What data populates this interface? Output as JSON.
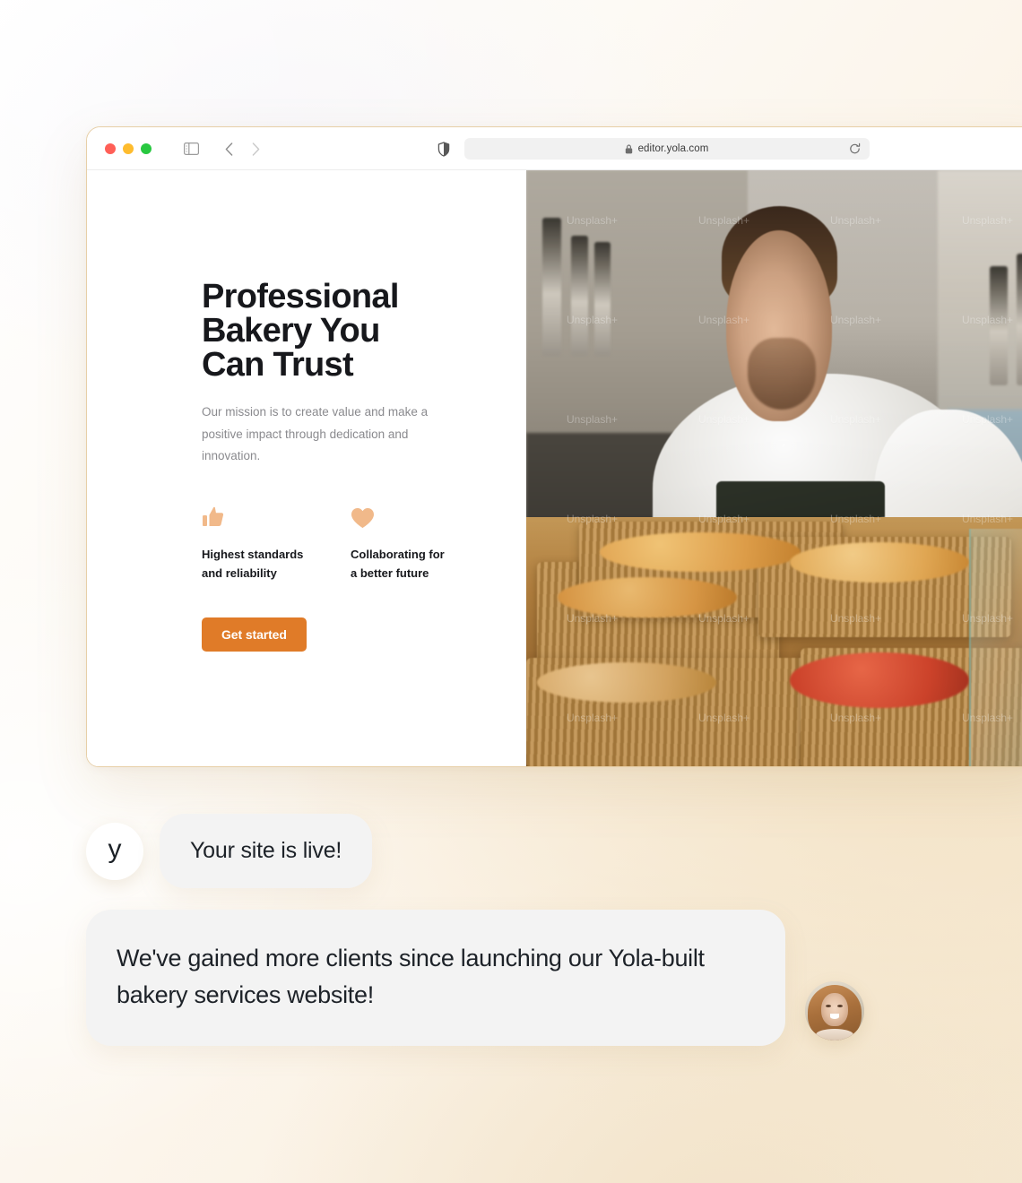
{
  "browser": {
    "traffic_lights": [
      "close",
      "minimize",
      "maximize"
    ],
    "url": "editor.yola.com",
    "lock_icon": "lock-icon",
    "reload_icon": "reload-icon",
    "sidebar_icon": "sidebar-toggle-icon",
    "back_icon": "chevron-left-icon",
    "forward_icon": "chevron-right-icon",
    "shield_icon": "privacy-shield-icon"
  },
  "site": {
    "hero": {
      "title": "Professional\nBakery You\nCan Trust",
      "subtitle": "Our mission is to create value and make a positive impact through dedication and innovation.",
      "cta_label": "Get started"
    },
    "features": [
      {
        "icon": "thumbs-up-icon",
        "text": "Highest standards\nand reliability"
      },
      {
        "icon": "heart-icon",
        "text": "Collaborating for\na better future"
      }
    ],
    "image_watermark": "Unsplash+"
  },
  "chat": {
    "logo_letter": "y",
    "message_1": "Your site is live!",
    "message_2": "We've gained more clients since launching our Yola-built bakery services website!"
  },
  "colors": {
    "accent_orange": "#e07b28",
    "icon_peach": "#f1b98a",
    "text_dark": "#17181c",
    "text_muted": "#8a8a8e",
    "bubble_bg": "#f3f3f3",
    "window_border": "#e7cfa7"
  }
}
